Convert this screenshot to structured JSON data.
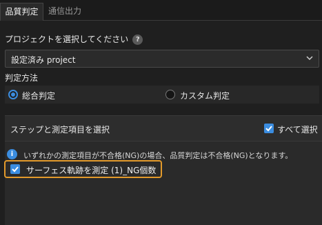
{
  "tabs": [
    {
      "label": "品質判定",
      "active": true
    },
    {
      "label": "通信出力",
      "active": false
    }
  ],
  "project": {
    "label": "プロジェクトを選択してください",
    "help_icon": "help-icon",
    "selected": "設定済み project"
  },
  "method": {
    "label": "判定方法",
    "options": [
      {
        "label": "総合判定",
        "selected": true
      },
      {
        "label": "カスタム判定",
        "selected": false
      }
    ]
  },
  "steps": {
    "title": "ステップと測定項目を選択",
    "select_all_label": "すべて選択",
    "select_all_checked": true,
    "info_text": "いずれかの測定項目が不合格(NG)の場合、品質判定は不合格(NG)となります。",
    "items": [
      {
        "label": "サーフェス軌跡を測定 (1)_NG個数",
        "checked": true
      }
    ]
  },
  "colors": {
    "accent": "#3b8de0",
    "highlight": "#e39a2b",
    "background": "#1f1f1f"
  }
}
